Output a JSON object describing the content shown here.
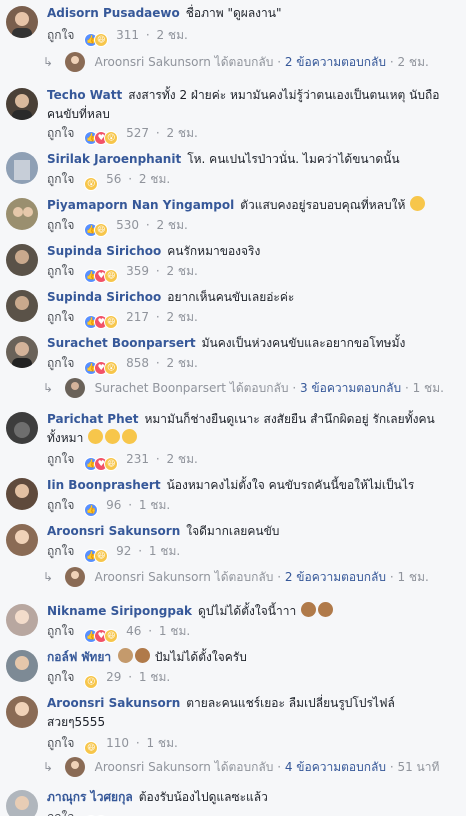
{
  "like_label": "ถูกใจ",
  "sep": "·",
  "comments": [
    {
      "author": "Adisorn Pusadaewo",
      "text": "ชื่อภาพ \"ดูผลงาน\"",
      "reactions": [
        "like",
        "haha"
      ],
      "count": "311",
      "time": "2 ชม.",
      "av": "#7a5f4d"
    },
    {
      "author": "Techo Watt",
      "text": "สงสารทั้ง 2 ฝ่ายค่ะ หมามันคงไม่รู้ว่าตนเองเป็นตนเหตุ นับถือ คนขับที่หลบ",
      "reactions": [
        "like",
        "love",
        "wow"
      ],
      "count": "527",
      "time": "2 ชม.",
      "av": "#4a4037"
    },
    {
      "author": "Sirilak Jaroenphanit",
      "text": "โห. คนเปนไรป่าวนั่น. ไมคว่าได้ขนาดนั้น",
      "reactions": [
        "wow"
      ],
      "count": "56",
      "time": "2 ชม.",
      "av": "#8fa0b5"
    },
    {
      "author": "Piyamaporn Nan Yingampol",
      "text": "ตัวแสบคงอยู่รอบอบคุณที่หลบให้",
      "reactions": [
        "like",
        "haha"
      ],
      "count": "530",
      "time": "2 ชม.",
      "av": "#9a8f6f"
    },
    {
      "author": "Supinda Sirichoo",
      "text": "คนรักหมาของจริง",
      "reactions": [
        "like",
        "love",
        "haha"
      ],
      "count": "359",
      "time": "2 ชม.",
      "av": "#5a5248"
    },
    {
      "author": "Supinda Sirichoo",
      "text": "อยากเห็นคนขับเลยอ่ะค่ะ",
      "reactions": [
        "like",
        "love",
        "haha"
      ],
      "count": "217",
      "time": "2 ชม.",
      "av": "#5a5248"
    },
    {
      "author": "Surachet Boonparsert",
      "text": "มันคงเป็นห่วงคนขับและอยากขอโทษมั้ง",
      "reactions": [
        "like",
        "love",
        "wow"
      ],
      "count": "858",
      "time": "2 ชม.",
      "av": "#6a6259"
    },
    {
      "author": "Parichat Phet",
      "text": "หมามันก็ช่างยืนดูเนาะ สงสัยยืน สำนึกผิดอยู่ รักเลยทั้งคน ทั้งหมา",
      "reactions": [
        "like",
        "love",
        "haha"
      ],
      "count": "231",
      "time": "2 ชม.",
      "av": "#3d3d3d"
    },
    {
      "author": "Iin Boonprashert",
      "text": "น้องหมาคงไม่ตั้งใจ คนขับรถคันนี้ขอให้ไม่เป็นไร",
      "reactions": [
        "like"
      ],
      "count": "96",
      "time": "1 ชม.",
      "av": "#5f4a3c"
    },
    {
      "author": "Aroonsri Sakunsorn",
      "text": "ใจดีมากเลยคนขับ",
      "reactions": [
        "like",
        "haha"
      ],
      "count": "92",
      "time": "1 ชม.",
      "av": "#8a6b55"
    },
    {
      "author": "Nikname Siripongpak",
      "text": "ดูปไม่ได้ตั้งใจนี้าาา",
      "reactions": [
        "like",
        "love",
        "haha"
      ],
      "count": "46",
      "time": "1 ชม.",
      "av": "#b8a7a0"
    },
    {
      "author": "กอล์ฟ พัทยา",
      "text": "ปัมไม่ได้ตั้งใจครับ",
      "reactions": [
        "wow"
      ],
      "count": "29",
      "time": "1 ชม.",
      "av": "#7d8a95"
    },
    {
      "author": "Aroonsri Sakunsorn",
      "text": "ตายละคนแชร์เยอะ ลืมเปลี่ยนรูปโปรไฟล์ สวยๆ5555",
      "reactions": [
        "haha"
      ],
      "count": "110",
      "time": "1 ชม.",
      "av": "#8a6b55"
    },
    {
      "author": "ภาณุกร ไวศยกุล",
      "text": "ต้องรับน้องไปดูแลซะแล้ว",
      "reactions": [
        "like",
        "love"
      ],
      "count": "",
      "time": "",
      "av": "#b0b6bd"
    }
  ],
  "replies": [
    {
      "who": "Aroonsri Sakunsorn",
      "action": "ได้ตอบกลับ",
      "sep": "·",
      "link": "2 ข้อความตอบกลับ",
      "time": "2 ชม.",
      "av": "#8a6b55"
    },
    {
      "who": "Surachet Boonparsert",
      "action": "ได้ตอบกลับ",
      "sep": "·",
      "link": "3 ข้อความตอบกลับ",
      "time": "1 ชม.",
      "av": "#6a6259"
    },
    {
      "who": "Aroonsri Sakunsorn",
      "action": "ได้ตอบกลับ",
      "sep": "·",
      "link": "2 ข้อความตอบกลับ",
      "time": "1 ชม.",
      "av": "#8a6b55"
    },
    {
      "who": "Aroonsri Sakunsorn",
      "action": "ได้ตอบกลับ",
      "sep": "·",
      "link": "4 ข้อความตอบกลับ",
      "time": "51 นาที",
      "av": "#8a6b55"
    }
  ],
  "colors": {
    "link": "#365899",
    "meta": "#90949c",
    "bg": "#f6f7f9"
  }
}
